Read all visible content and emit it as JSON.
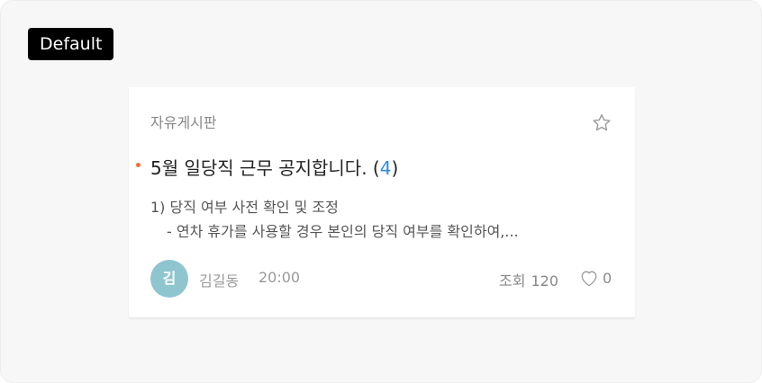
{
  "variant_label": "Default",
  "card": {
    "board_name": "자유게시판",
    "title": "5월 일당직 근무 공지합니다. (",
    "comment_count": "4",
    "title_close": ")",
    "excerpt_line1": "1) 당직 여부 사전 확인 및 조정",
    "excerpt_line2": "- 연차 휴가를 사용할 경우 본인의 당직 여부를 확인하여,...",
    "author_initial": "김",
    "author_name": "김길동",
    "time": "20:00",
    "views_label": "조회",
    "views_count": "120",
    "like_count": "0"
  },
  "colors": {
    "new_dot": "#f07035",
    "comment_count": "#2a8ce0",
    "avatar_bg": "#8ec5cf"
  },
  "icons": {
    "bookmark": "star-outline-icon",
    "like": "heart-outline-icon"
  }
}
